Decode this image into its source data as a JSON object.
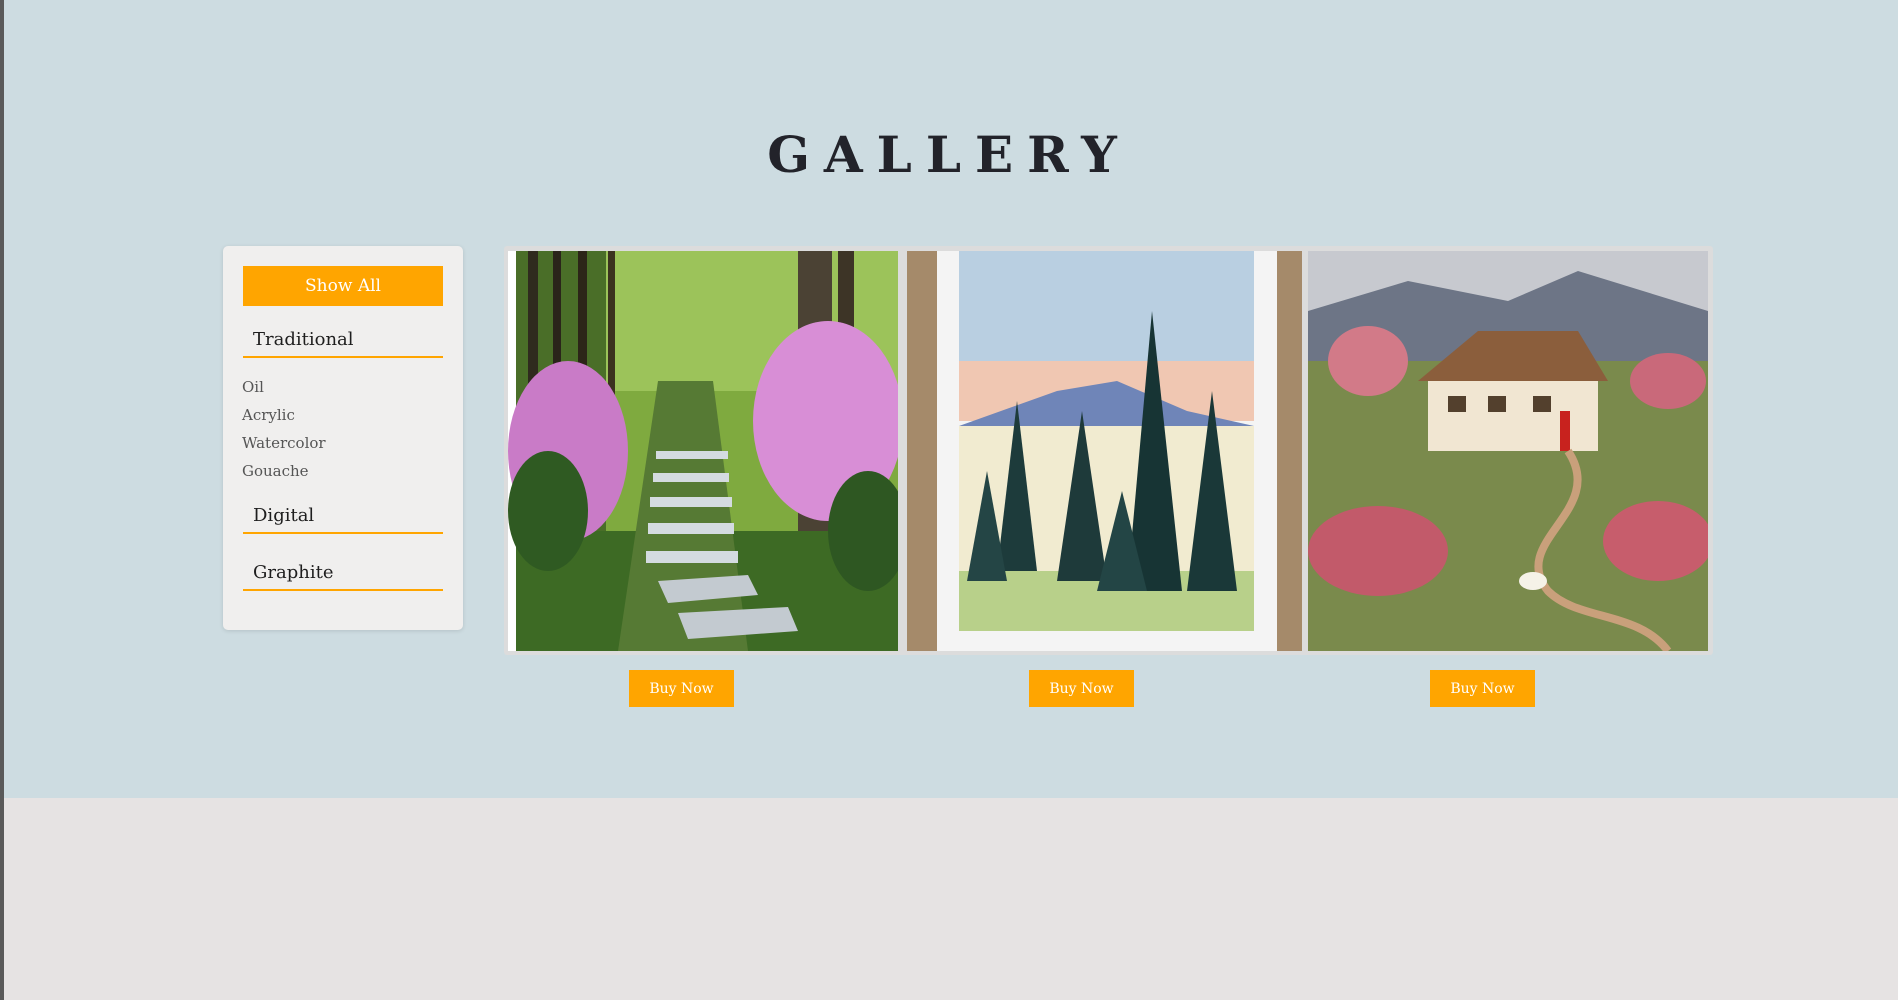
{
  "page": {
    "title": "GALLERY"
  },
  "sidebar": {
    "show_all": "Show All",
    "categories": [
      {
        "label": "Traditional",
        "subcategories": [
          "Oil",
          "Acrylic",
          "Watercolor",
          "Gouache"
        ]
      },
      {
        "label": "Digital"
      },
      {
        "label": "Graphite"
      }
    ]
  },
  "gallery": {
    "items": [
      {
        "artwork": "forest-path-rhododendron-painting",
        "buy_label": "Buy Now"
      },
      {
        "artwork": "mountain-pines-watercolor-painting",
        "buy_label": "Buy Now"
      },
      {
        "artwork": "cottage-landscape-gouache-painting",
        "buy_label": "Buy Now"
      }
    ]
  },
  "colors": {
    "accent": "#ffa500",
    "hero_background": "#cddce1",
    "footer_background": "#e6e3e3",
    "sidebar_background": "#f0efee"
  }
}
